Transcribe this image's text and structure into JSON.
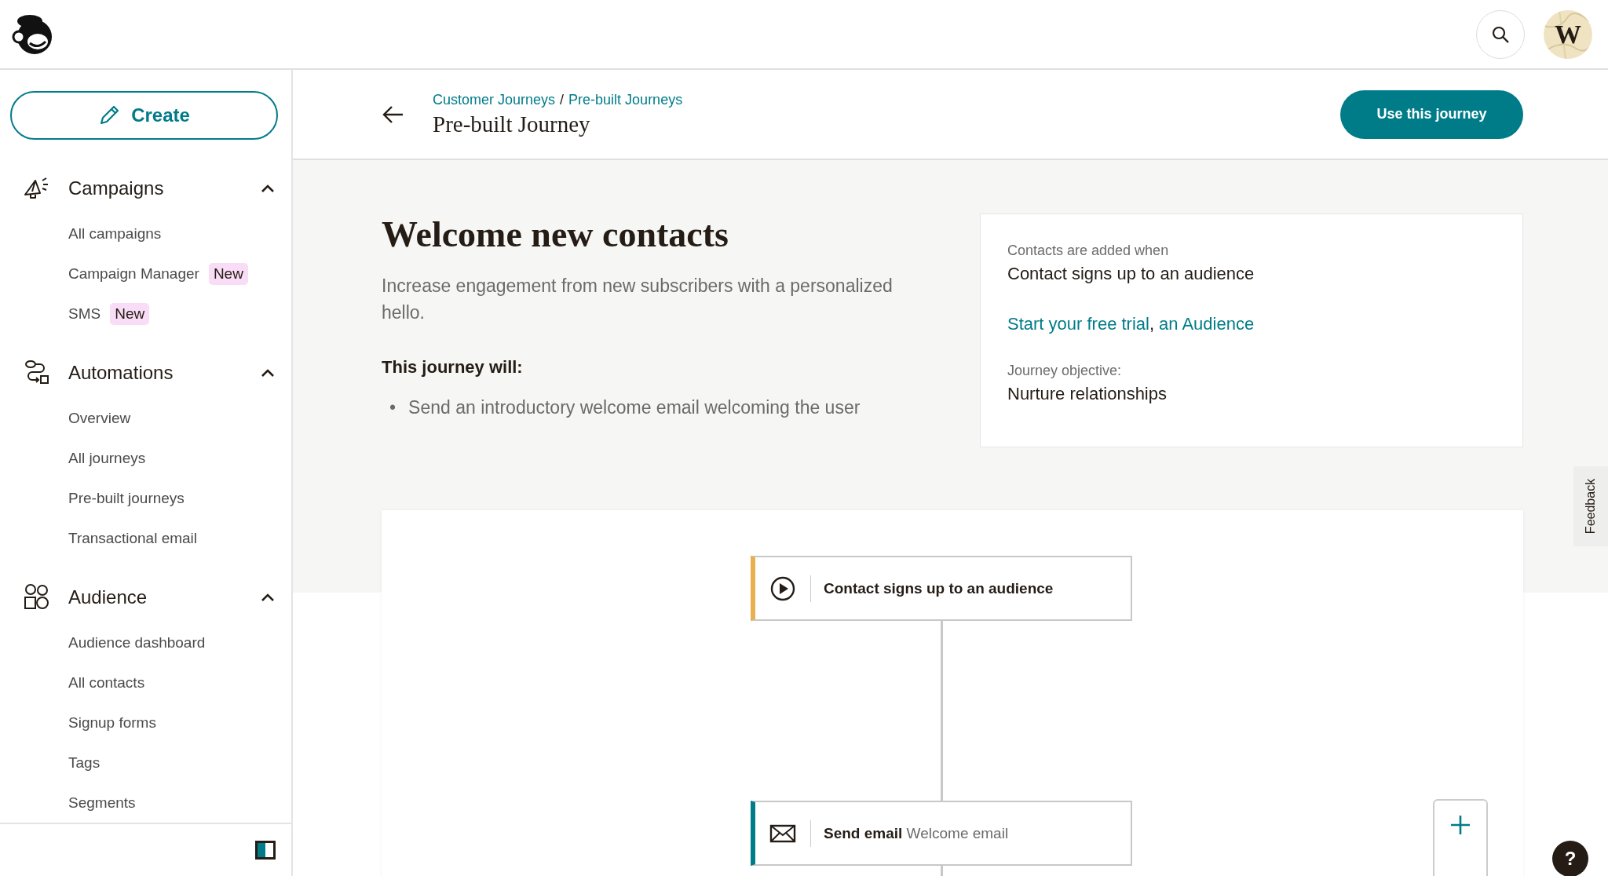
{
  "topbar": {
    "avatar": {
      "initial": "W"
    }
  },
  "sidebar": {
    "create_button": "Create",
    "sections": [
      {
        "label": "Campaigns",
        "expanded": true,
        "items": [
          {
            "label": "All campaigns"
          },
          {
            "label": "Campaign Manager",
            "badge": "New"
          },
          {
            "label": "SMS",
            "badge": "New"
          }
        ]
      },
      {
        "label": "Automations",
        "expanded": true,
        "items": [
          {
            "label": "Overview"
          },
          {
            "label": "All journeys"
          },
          {
            "label": "Pre-built journeys"
          },
          {
            "label": "Transactional email"
          }
        ]
      },
      {
        "label": "Audience",
        "expanded": true,
        "items": [
          {
            "label": "Audience dashboard"
          },
          {
            "label": "All contacts"
          },
          {
            "label": "Signup forms"
          },
          {
            "label": "Tags"
          },
          {
            "label": "Segments"
          }
        ]
      }
    ]
  },
  "page_header": {
    "breadcrumb": [
      {
        "label": "Customer Journeys"
      },
      {
        "label": "Pre-built Journeys"
      }
    ],
    "breadcrumb_separator": "/",
    "title": "Pre-built Journey",
    "action_button": "Use this journey"
  },
  "journey": {
    "title": "Welcome new contacts",
    "description": "Increase engagement from new subscribers with a personalized hello.",
    "steps_heading": "This journey will:",
    "bullet": "•",
    "steps": [
      "Send an introductory welcome email welcoming the user"
    ]
  },
  "info_card": {
    "trigger_label": "Contacts are added when",
    "trigger_value": "Contact signs up to an audience",
    "links": [
      {
        "label": "Start your free trial"
      },
      {
        "label": "an Audience"
      }
    ],
    "link_separator": ",",
    "objective_label": "Journey objective:",
    "objective_value": "Nurture relationships"
  },
  "canvas": {
    "nodes": [
      {
        "kind": "trigger",
        "title": "Contact signs up to an audience"
      },
      {
        "kind": "email",
        "title": "Send email",
        "detail": "Welcome email"
      }
    ]
  },
  "feedback_tab": "Feedback",
  "help_button": "?"
}
